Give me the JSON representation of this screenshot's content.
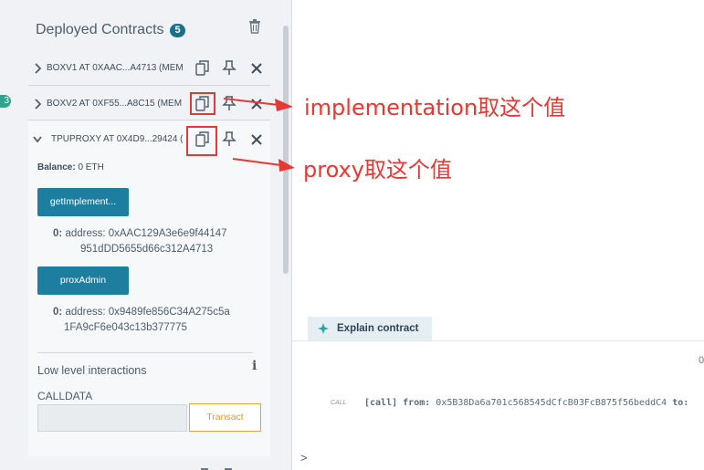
{
  "panel": {
    "title": "Deployed Contracts",
    "count": "5",
    "side_badge": "3"
  },
  "contracts": [
    {
      "label": "BOXV1 AT 0XAAC...A4713 (MEM",
      "expanded": false
    },
    {
      "label": "BOXV2 AT 0XF55...A8C15 (MEM",
      "expanded": false
    },
    {
      "label": "TPUPROXY AT 0X4D9...29424 (",
      "expanded": true
    }
  ],
  "expanded_contract": {
    "balance_label": "Balance:",
    "balance_value": "0 ETH",
    "functions": [
      {
        "label": "getImplement...",
        "result_index": "0:",
        "result_line1": "address: 0xAAC129A3e6e9f44147",
        "result_line2": "951dDD5655d66c312A4713"
      },
      {
        "label": "proxAdmin",
        "result_index": "0:",
        "result_line1": "address: 0x9489fe856C34A275c5a",
        "result_line2": "1FA9cF6e043c13b377775"
      }
    ],
    "low_level_title": "Low level interactions",
    "info_glyph": "i",
    "calldata_label": "CALLDATA",
    "calldata_value": "",
    "transact_label": "Transact"
  },
  "annotations": {
    "implementation_note": "implementation取这个值",
    "proxy_note": "proxy取这个值",
    "color": "#e53935"
  },
  "terminal": {
    "explain_label": "Explain contract",
    "zero_marker": "0",
    "call_tag": "CALL",
    "call_text": "[call]",
    "from_label": "from:",
    "from_value": "0x5B38Da6a701c568545dCfcB03FcB875f56beddC4",
    "to_label": "to:",
    "prompt": ">"
  },
  "colors": {
    "accent_button": "#1e7ea0",
    "badge": "#1a6f8e",
    "transact_border": "#e6a23c"
  }
}
